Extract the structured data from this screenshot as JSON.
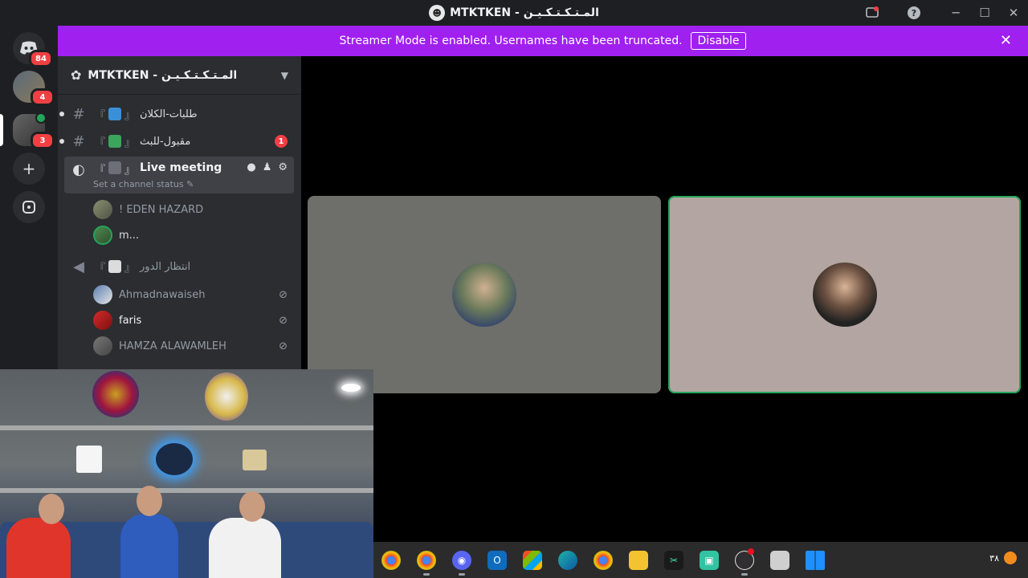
{
  "window": {
    "title": "MTKTKEN - المـتـكـتـكـيـن"
  },
  "banner": {
    "text": "Streamer Mode is enabled. Usernames have been truncated.",
    "disable_label": "Disable"
  },
  "rail": {
    "dm_badge": "84",
    "server1_badge": "4",
    "server2_badge": "3"
  },
  "server": {
    "name": "MTKTKEN - المـتـكـتـكـيـن"
  },
  "channels": [
    {
      "name": "طلبات-الكلان",
      "prefix": "『",
      "suffix": "』"
    },
    {
      "name": "مقبول-للبث",
      "prefix": "『",
      "suffix": "』",
      "badge": "1"
    },
    {
      "name": "Live meeting",
      "prefix": "『",
      "suffix": "』",
      "status": "Set a channel status"
    },
    {
      "name": "انتظار الدور",
      "prefix": "『",
      "suffix": "』"
    }
  ],
  "voice_users_live": [
    "! EDEN HAZARD",
    "m..."
  ],
  "voice_users_wait": [
    "Ahmadnawaiseh",
    "faris",
    "HAMZA ALAWAMLEH"
  ],
  "tray": {
    "clock": "٣٨"
  },
  "colors": {
    "accent_banner": "#a020f0",
    "speaking": "#23a559",
    "badge": "#f23f43"
  }
}
